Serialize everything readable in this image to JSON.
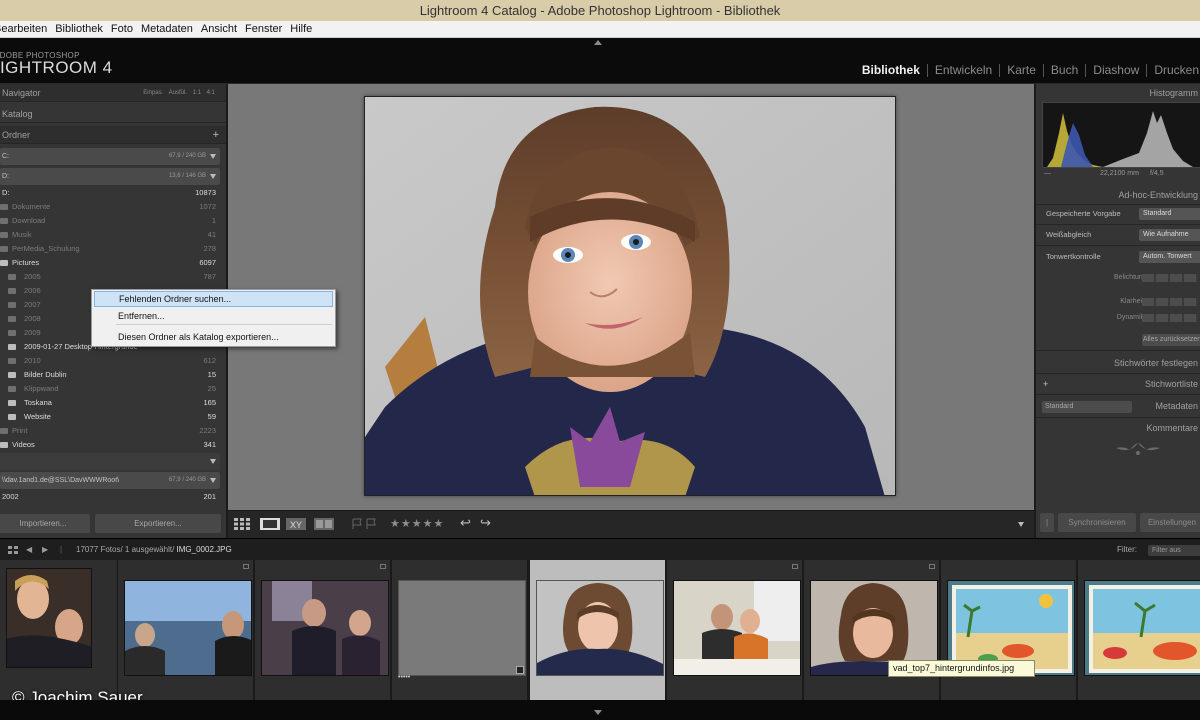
{
  "window_title": "Lightroom 4 Catalog - Adobe Photoshop Lightroom - Bibliothek",
  "menu": [
    "Bearbeiten",
    "Bibliothek",
    "Foto",
    "Metadaten",
    "Ansicht",
    "Fenster",
    "Hilfe"
  ],
  "brand": {
    "small": "ADOBE PHOTOSHOP",
    "big": "LIGHTROOM 4"
  },
  "modules": [
    {
      "label": "Bibliothek",
      "active": true
    },
    {
      "label": "Entwickeln",
      "active": false
    },
    {
      "label": "Karte",
      "active": false
    },
    {
      "label": "Buch",
      "active": false
    },
    {
      "label": "Diashow",
      "active": false
    },
    {
      "label": "Drucken",
      "active": false
    }
  ],
  "left_panel": {
    "navigator_title": "Navigator",
    "navigator_zoom": "Einpas.  Ausfül.  1:1  4:1",
    "catalog_title": "Katalog",
    "folders_title": "Ordner",
    "volume1": {
      "name": "C:",
      "stat": "67,9 / 240 GB"
    },
    "volume2": {
      "name": "D:",
      "stat": "13,6 / 146 GB"
    },
    "folders": [
      {
        "name": "D:",
        "count": "10873",
        "style": "bright",
        "indent": 0
      },
      {
        "name": "Dokumente",
        "count": "1072",
        "style": "dim",
        "indent": 1
      },
      {
        "name": "Download",
        "count": "1",
        "style": "dim",
        "indent": 1
      },
      {
        "name": "Musik",
        "count": "41",
        "style": "dim",
        "indent": 1
      },
      {
        "name": "PerMedia_Schulung",
        "count": "278",
        "style": "dim",
        "indent": 1
      },
      {
        "name": "Pictures",
        "count": "6097",
        "style": "bright",
        "indent": 0
      },
      {
        "name": "2005",
        "count": "787",
        "style": "dim",
        "indent": 1
      },
      {
        "name": "2006",
        "count": "",
        "style": "dim",
        "indent": 1
      },
      {
        "name": "2007",
        "count": "",
        "style": "dim",
        "indent": 1
      },
      {
        "name": "2008",
        "count": "",
        "style": "dim",
        "indent": 1
      },
      {
        "name": "2009",
        "count": "",
        "style": "dim",
        "indent": 1
      },
      {
        "name": "2009-01-27 Desktop-Hintergründe",
        "count": "",
        "style": "bright",
        "indent": 1
      },
      {
        "name": "2010",
        "count": "612",
        "style": "dim",
        "indent": 1
      },
      {
        "name": "Bilder Dublin",
        "count": "15",
        "style": "bright",
        "indent": 1
      },
      {
        "name": "Klippwand",
        "count": "25",
        "style": "dim",
        "indent": 1
      },
      {
        "name": "Toskana",
        "count": "165",
        "style": "bright",
        "indent": 1
      },
      {
        "name": "Website",
        "count": "59",
        "style": "bright",
        "indent": 1
      },
      {
        "name": "Print",
        "count": "2223",
        "style": "dim",
        "indent": 0
      },
      {
        "name": "Videos",
        "count": "341",
        "style": "bright",
        "indent": 0
      }
    ],
    "volume3": {
      "name": "\\\\dav.1and1.de@SSL\\DavWWWRoot\\",
      "stat": "67,9 / 240 GB"
    },
    "volume3_folder": {
      "name": "2002",
      "count": "201"
    },
    "import_label": "Importieren...",
    "export_label": "Exportieren..."
  },
  "context_menu": [
    {
      "label": "Fehlenden Ordner suchen...",
      "highlighted": true
    },
    {
      "label": "Entfernen...",
      "highlighted": false
    },
    {
      "label": "Diesen Ordner als Katalog exportieren...",
      "highlighted": false
    }
  ],
  "toolbar": {
    "stars": "★★★★★"
  },
  "right_panel": {
    "histogram_title": "Histogramm",
    "histogram_info": [
      "—",
      "22,2100 mm",
      "f/4,5"
    ],
    "quick_develop_title": "Ad-hoc-Entwicklung",
    "rows": [
      {
        "label": "Gespeicherte Vorgabe",
        "value": "Standard"
      },
      {
        "label": "Weißabgleich",
        "value": "Wie Aufnahme"
      },
      {
        "label": "Tonwertkontrolle",
        "value": "Autom. Tonwert"
      }
    ],
    "sub_rows": [
      "Belichtung",
      "Klarheit",
      "Dynamik"
    ],
    "reset_label": "Alles zurücksetzen",
    "keywords_title": "Stichwörter festlegen",
    "keyword_list_title": "Stichwortliste",
    "metadata_preset": "Standard",
    "metadata_title": "Metadaten",
    "comments_title": "Kommentare",
    "sync_label": "Synchronisieren",
    "sync_settings_label": "Einstellungen"
  },
  "filmstrip": {
    "info_prefix": "17077 Fotos/ 1 ausgewählt/",
    "filename": "IMG_0002.JPG",
    "filter_label": "Filter:",
    "filter_value": "Filter aus",
    "tooltip": "vad_top7_hintergrundinfos.jpg",
    "dots": "•••••"
  },
  "copyright": "© Joachim Sauer"
}
